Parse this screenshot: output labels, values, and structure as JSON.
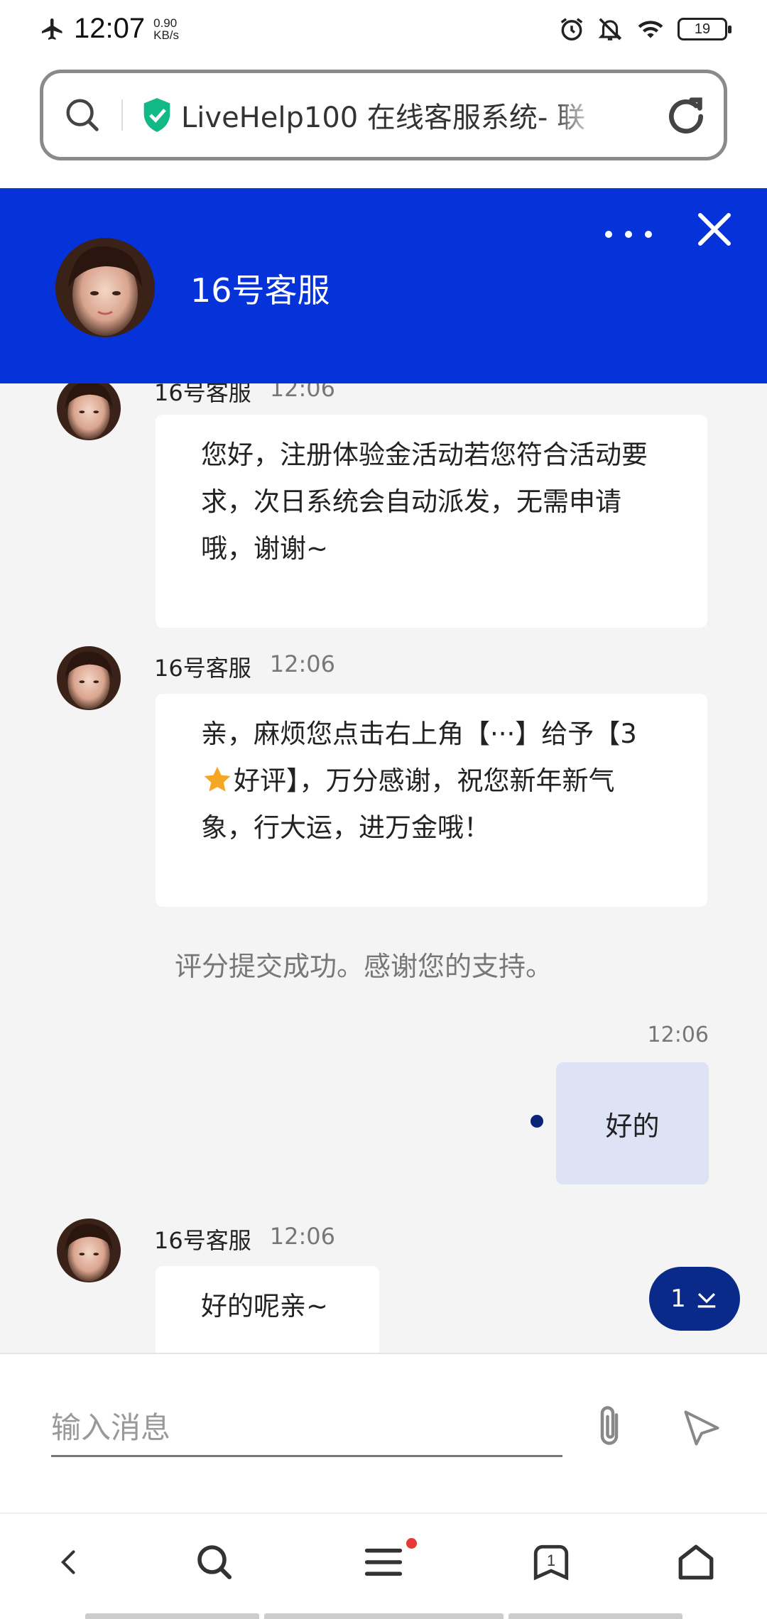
{
  "status_bar": {
    "time": "12:07",
    "speed_value": "0.90",
    "speed_unit": "KB/s",
    "battery": "19"
  },
  "url_bar": {
    "title": "LiveHelp100 在线客服系统- 联"
  },
  "header": {
    "agent_name": "16号客服"
  },
  "messages": [
    {
      "sender": "16号客服",
      "time": "12:06",
      "text": "您好，注册体验金活动若您符合活动要求，次日系统会自动派发，无需申请哦，谢谢~"
    },
    {
      "sender": "16号客服",
      "time": "12:06",
      "text_part1": "亲，麻烦您点击右上角【···】给予【3",
      "text_part2": "好评】，万分感谢，祝您新年新气象，行大运，进万金哦！"
    },
    {
      "system": "评分提交成功。感谢您的支持。"
    },
    {
      "time": "12:06",
      "text": "好的",
      "outgoing": true
    },
    {
      "sender": "16号客服",
      "time": "12:06",
      "text": "好的呢亲~"
    }
  ],
  "unread_count": "1",
  "input": {
    "placeholder": "输入消息",
    "value": ""
  },
  "bottom_nav": {
    "tabs_count": "1"
  },
  "colors": {
    "header_blue": "#0532d9",
    "badge_navy": "#0a2a8a",
    "outgoing_bubble": "#dde2f4",
    "star": "#f5a623"
  },
  "icons": [
    "airplane-icon",
    "alarm-icon",
    "bell-off-icon",
    "wifi-icon",
    "battery-icon",
    "search-icon",
    "shield-check-icon",
    "reload-icon",
    "more-icon",
    "close-icon",
    "chevron-down-icon",
    "paperclip-icon",
    "send-icon",
    "back-icon",
    "menu-icon",
    "tabs-icon",
    "home-icon",
    "star-icon"
  ]
}
